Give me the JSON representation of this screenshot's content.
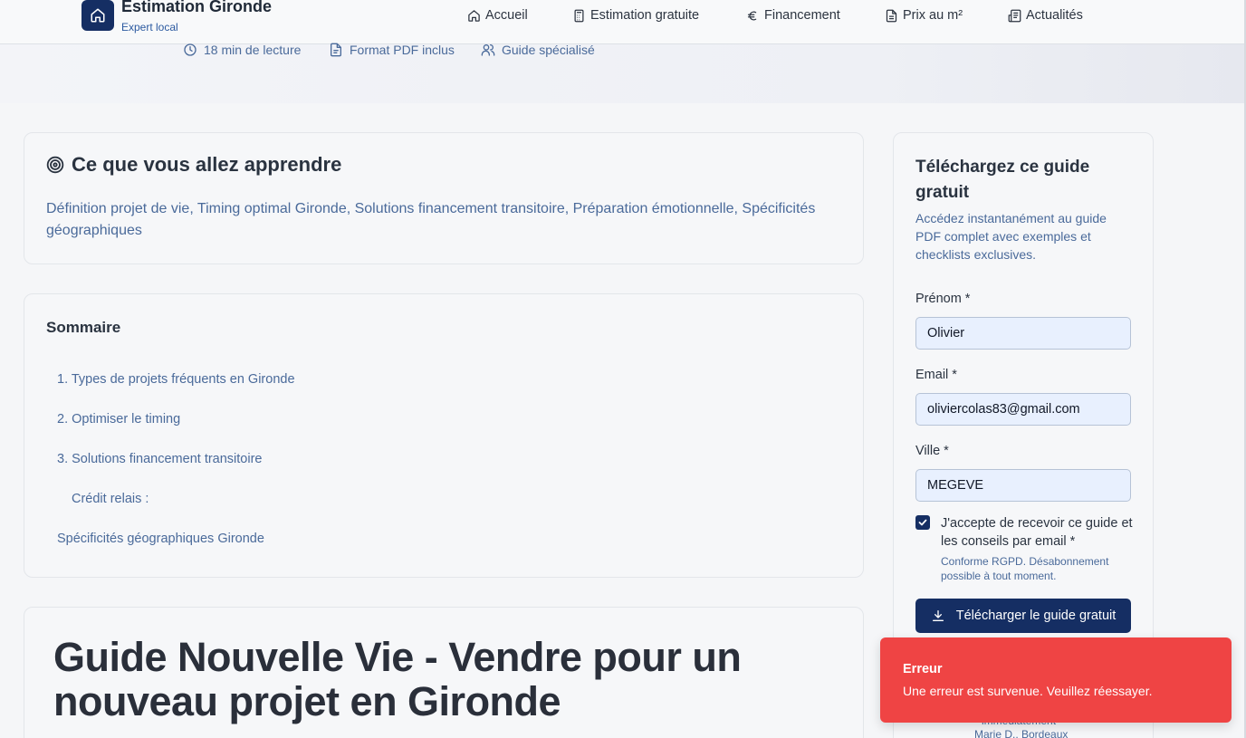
{
  "header": {
    "brand_title": "Estimation Gironde",
    "brand_subtitle": "Expert local",
    "nav": [
      {
        "label": "Accueil",
        "icon": "home-icon"
      },
      {
        "label": "Estimation gratuite",
        "icon": "calculator-icon"
      },
      {
        "label": "Financement",
        "icon": "euro-icon"
      },
      {
        "label": "Prix au m²",
        "icon": "document-icon"
      },
      {
        "label": "Actualités",
        "icon": "newspaper-icon"
      }
    ]
  },
  "hero": {
    "meta": [
      {
        "label": "18 min de lecture",
        "icon": "clock-icon"
      },
      {
        "label": "Format PDF inclus",
        "icon": "file-icon"
      },
      {
        "label": "Guide spécialisé",
        "icon": "users-icon"
      }
    ]
  },
  "learn": {
    "title": "Ce que vous allez apprendre",
    "icon": "target-icon",
    "text": "Définition projet de vie, Timing optimal Gironde, Solutions financement transitoire, Préparation émotionnelle, Spécificités géographiques"
  },
  "toc": {
    "title": "Sommaire",
    "items": [
      "1. Types de projets fréquents en Gironde",
      "2. Optimiser le timing",
      "3. Solutions financement transitoire",
      "Crédit relais :",
      "Spécificités géographiques Gironde"
    ]
  },
  "article": {
    "title": "Guide Nouvelle Vie - Vendre pour un nouveau projet en Gironde"
  },
  "download_form": {
    "title": "Téléchargez ce guide gratuit",
    "description": "Accédez instantanément au guide PDF complet avec exemples et checklists exclusives.",
    "firstname_label": "Prénom *",
    "firstname_value": "Olivier",
    "email_label": "Email *",
    "email_value": "oliviercolas83@gmail.com",
    "city_label": "Ville *",
    "city_value": "MEGEVE",
    "consent_label": "J'accepte de recevoir ce guide et les conseils par email *",
    "consent_checked": true,
    "consent_note": "Conforme RGPD. Désabonnement possible à tout moment.",
    "submit_label": "Télécharger le guide gratuit",
    "testimonial_line": "immédiatement",
    "testimonial_author": "Marie D., Bordeaux"
  },
  "toast": {
    "title": "Erreur",
    "message": "Une erreur est survenue. Veuillez réessayer.",
    "color": "#ef4444"
  },
  "colors": {
    "primary": "#152e63",
    "link_text": "#4a6a9a",
    "error": "#ef4444"
  }
}
